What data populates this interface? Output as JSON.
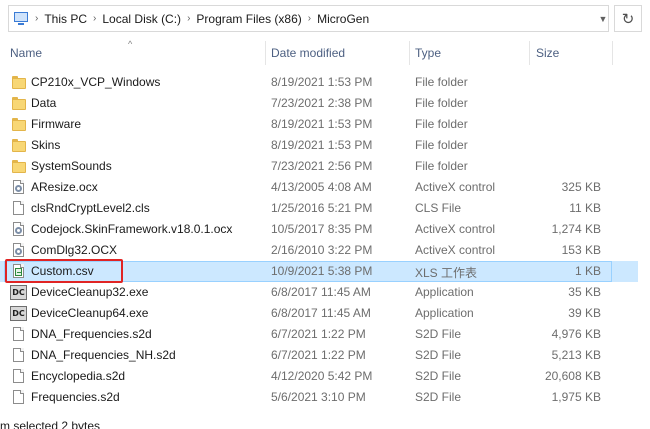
{
  "address_bar": {
    "crumbs": [
      "This PC",
      "Local Disk (C:)",
      "Program Files (x86)",
      "MicroGen"
    ]
  },
  "columns": {
    "name": "Name",
    "date": "Date modified",
    "type": "Type",
    "size": "Size"
  },
  "files": [
    {
      "name": "CP210x_VCP_Windows",
      "date": "8/19/2021 1:53 PM",
      "type": "File folder",
      "size": "",
      "icon": "folder-icon"
    },
    {
      "name": "Data",
      "date": "7/23/2021 2:38 PM",
      "type": "File folder",
      "size": "",
      "icon": "folder-icon"
    },
    {
      "name": "Firmware",
      "date": "8/19/2021 1:53 PM",
      "type": "File folder",
      "size": "",
      "icon": "folder-icon"
    },
    {
      "name": "Skins",
      "date": "8/19/2021 1:53 PM",
      "type": "File folder",
      "size": "",
      "icon": "folder-icon"
    },
    {
      "name": "SystemSounds",
      "date": "7/23/2021 2:56 PM",
      "type": "File folder",
      "size": "",
      "icon": "folder-icon"
    },
    {
      "name": "AResize.ocx",
      "date": "4/13/2005 4:08 AM",
      "type": "ActiveX control",
      "size": "325 KB",
      "icon": "activex-file-icon"
    },
    {
      "name": "clsRndCryptLevel2.cls",
      "date": "1/25/2016 5:21 PM",
      "type": "CLS File",
      "size": "11 KB",
      "icon": "generic-file-icon"
    },
    {
      "name": "Codejock.SkinFramework.v18.0.1.ocx",
      "date": "10/5/2017 8:35 PM",
      "type": "ActiveX control",
      "size": "1,274 KB",
      "icon": "activex-file-icon"
    },
    {
      "name": "ComDlg32.OCX",
      "date": "2/16/2010 3:22 PM",
      "type": "ActiveX control",
      "size": "153 KB",
      "icon": "activex-file-icon"
    },
    {
      "name": "Custom.csv",
      "date": "10/9/2021 5:38 PM",
      "type": "XLS 工作表",
      "size": "1 KB",
      "icon": "spreadsheet-file-icon",
      "selected": true
    },
    {
      "name": "DeviceCleanup32.exe",
      "date": "6/8/2017 11:45 AM",
      "type": "Application",
      "size": "35 KB",
      "icon": "dc-app-icon"
    },
    {
      "name": "DeviceCleanup64.exe",
      "date": "6/8/2017 11:45 AM",
      "type": "Application",
      "size": "39 KB",
      "icon": "dc-app-icon"
    },
    {
      "name": "DNA_Frequencies.s2d",
      "date": "6/7/2021 1:22 PM",
      "type": "S2D File",
      "size": "4,976 KB",
      "icon": "generic-file-icon"
    },
    {
      "name": "DNA_Frequencies_NH.s2d",
      "date": "6/7/2021 1:22 PM",
      "type": "S2D File",
      "size": "5,213 KB",
      "icon": "generic-file-icon"
    },
    {
      "name": "Encyclopedia.s2d",
      "date": "4/12/2020 5:42 PM",
      "type": "S2D File",
      "size": "20,608 KB",
      "icon": "generic-file-icon"
    },
    {
      "name": "Frequencies.s2d",
      "date": "5/6/2021 3:10 PM",
      "type": "S2D File",
      "size": "1,975 KB",
      "icon": "generic-file-icon"
    }
  ],
  "icons": {
    "exe_label": "DC"
  },
  "status_bar": {
    "text": "m selected  2 bytes"
  }
}
